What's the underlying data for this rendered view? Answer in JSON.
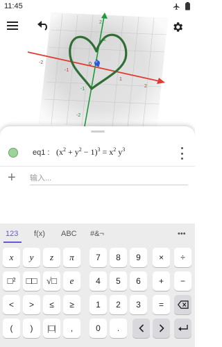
{
  "status_bar": {
    "time": "11:45",
    "icons": [
      "airplane-icon",
      "battery-icon"
    ]
  },
  "toolbar": {
    "menu_icon": "menu-icon",
    "undo_icon": "undo-icon",
    "settings_icon": "gear-icon"
  },
  "graph": {
    "axis_colors": {
      "x": "#e03c31",
      "y": "#1c9a3c",
      "z": "#2a57d6"
    },
    "curve_color": "#2f6e35",
    "x_ticks": [
      "-2",
      "-1",
      "1",
      "2"
    ],
    "y_ticks": [
      "2",
      "1",
      "-1",
      "-2"
    ],
    "origin_label": "0"
  },
  "algebra": {
    "items": [
      {
        "label": "eq1 :",
        "lhs_base": "(x",
        "lhs_exp1": "2",
        "lhs_mid": " + y",
        "lhs_exp2": "2",
        "lhs_tail": " − 1)",
        "lhs_exp3": "3",
        "equals": " = x",
        "rhs_exp1": "2",
        "rhs_mid": " y",
        "rhs_exp2": "3",
        "color": "#9ed39b"
      }
    ],
    "input_placeholder": "输入..."
  },
  "keyboard": {
    "tabs": [
      "123",
      "f(x)",
      "ABC",
      "#&¬",
      "•••"
    ],
    "active_tab": "123",
    "rows": [
      [
        "x",
        "y",
        "z",
        "π",
        "7",
        "8",
        "9",
        "×",
        "÷"
      ],
      [
        "□²",
        "□□",
        "√□",
        "e",
        "4",
        "5",
        "6",
        "+",
        "−"
      ],
      [
        "<",
        ">",
        "≤",
        "≥",
        "1",
        "2",
        "3",
        "=",
        "⌫"
      ],
      [
        "(",
        ")",
        "|□|",
        ",",
        "0",
        ".",
        "<",
        ">",
        "↵"
      ]
    ],
    "accent": "#6557d2"
  }
}
